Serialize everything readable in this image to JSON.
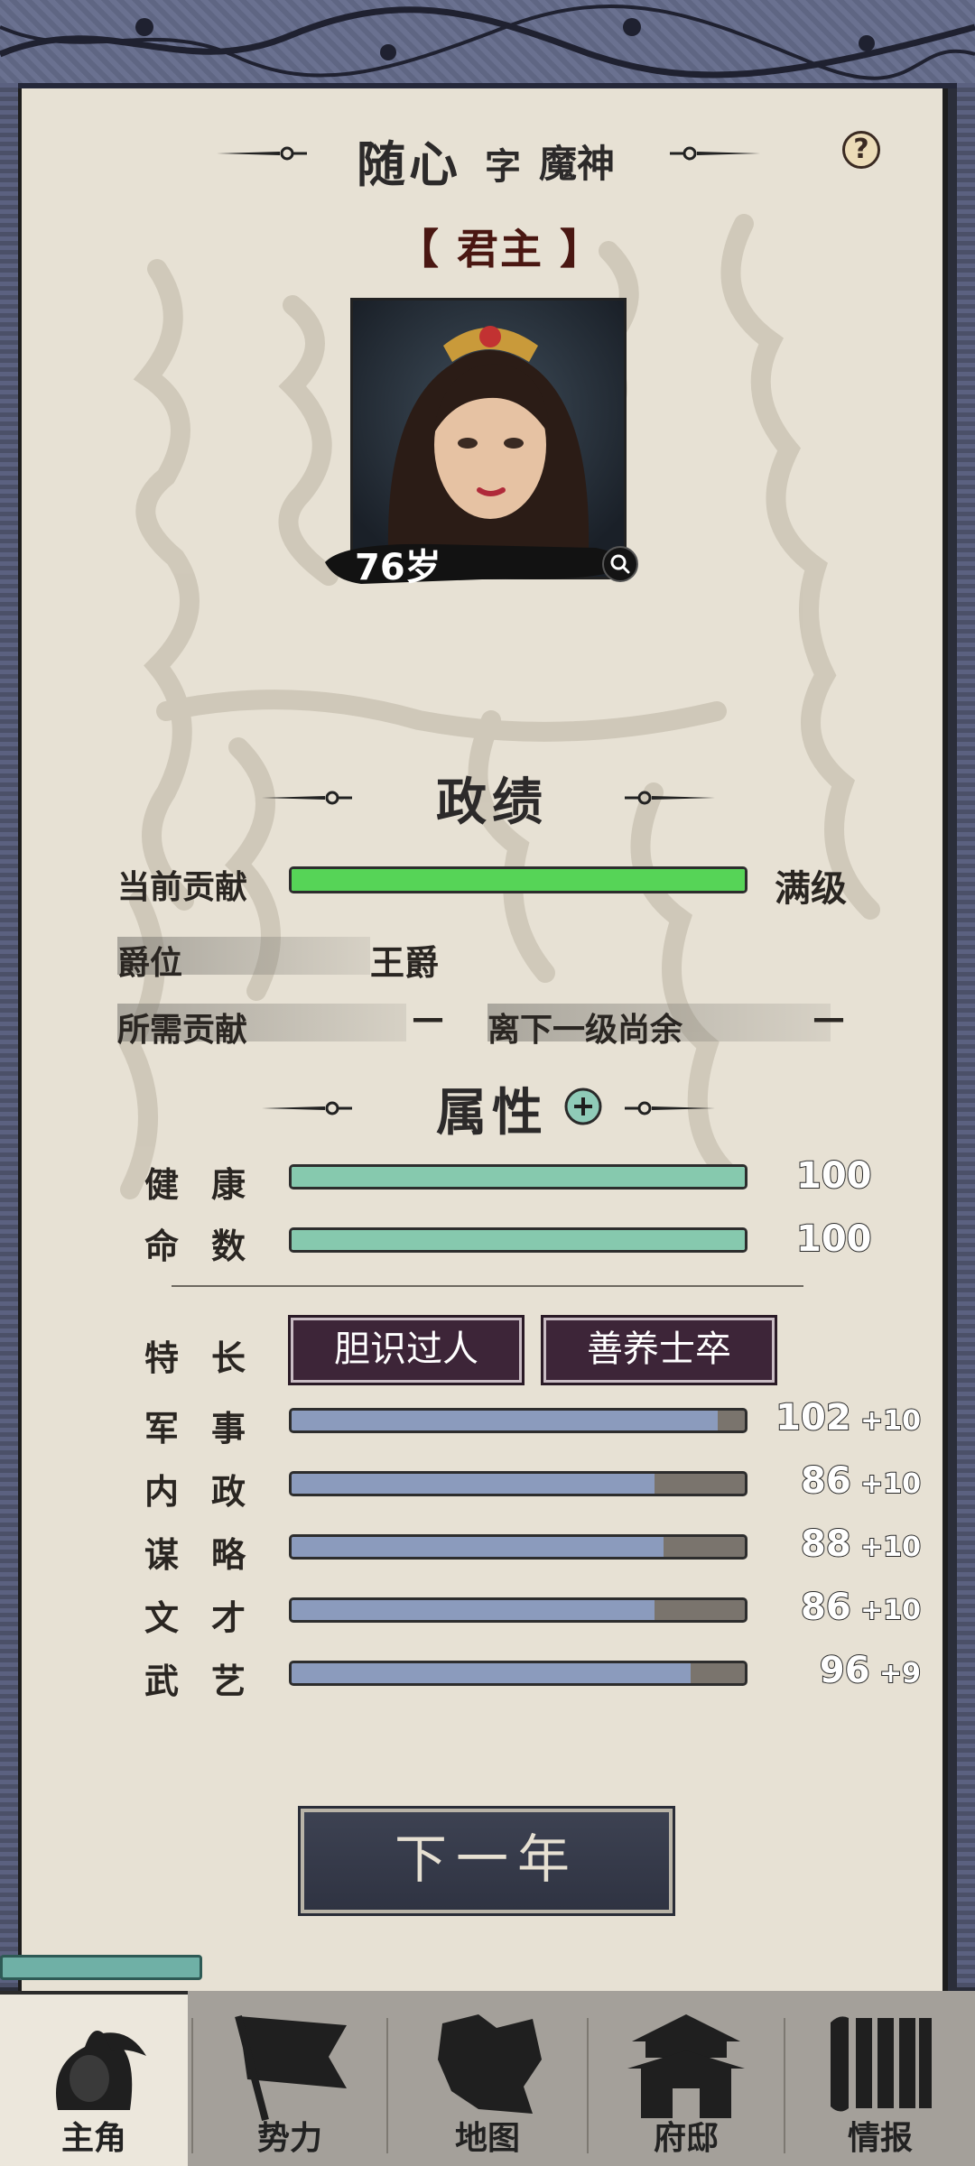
{
  "header": {
    "name": "随心",
    "zi_label": "字",
    "courtesy_name": "魔神",
    "help_icon": "?",
    "role": "【 君主 】"
  },
  "portrait": {
    "age": "76岁"
  },
  "merit": {
    "section_title": "政绩",
    "contribution_label": "当前贡献",
    "contribution_fraction": 1.0,
    "contribution_status": "满级",
    "rank_label": "爵位",
    "rank_value": "王爵",
    "required_label": "所需贡献",
    "required_value": "—",
    "remaining_label": "离下一级尚余",
    "remaining_value": "—"
  },
  "attributes": {
    "section_title": "属性",
    "health": {
      "label": "健康",
      "value": "100",
      "fraction": 1.0
    },
    "fate": {
      "label": "命数",
      "value": "100",
      "fraction": 1.0
    },
    "specialty_label": "特长",
    "traits": [
      "胆识过人",
      "善养士卒"
    ],
    "stats": [
      {
        "label": "军事",
        "value": "102",
        "bonus": "+10",
        "fraction": 0.94
      },
      {
        "label": "内政",
        "value": "86",
        "bonus": "+10",
        "fraction": 0.8
      },
      {
        "label": "谋略",
        "value": "88",
        "bonus": "+10",
        "fraction": 0.82
      },
      {
        "label": "文才",
        "value": "86",
        "bonus": "+10",
        "fraction": 0.8
      },
      {
        "label": "武艺",
        "value": "96",
        "bonus": "+9",
        "fraction": 0.88
      }
    ]
  },
  "actions": {
    "next_year": "下一年"
  },
  "nav": {
    "items": [
      {
        "label": "主角",
        "active": true
      },
      {
        "label": "势力",
        "active": false
      },
      {
        "label": "地图",
        "active": false
      },
      {
        "label": "府邸",
        "active": false
      },
      {
        "label": "情报",
        "active": false
      }
    ]
  },
  "colors": {
    "contribution_fill": "#56d457",
    "vital_fill": "#86c9ae",
    "stat_fill": "#8b9bbd",
    "trait_bg": "#3d2538",
    "button_bg": "#3a3e4d",
    "paper": "#e7e1d4"
  }
}
